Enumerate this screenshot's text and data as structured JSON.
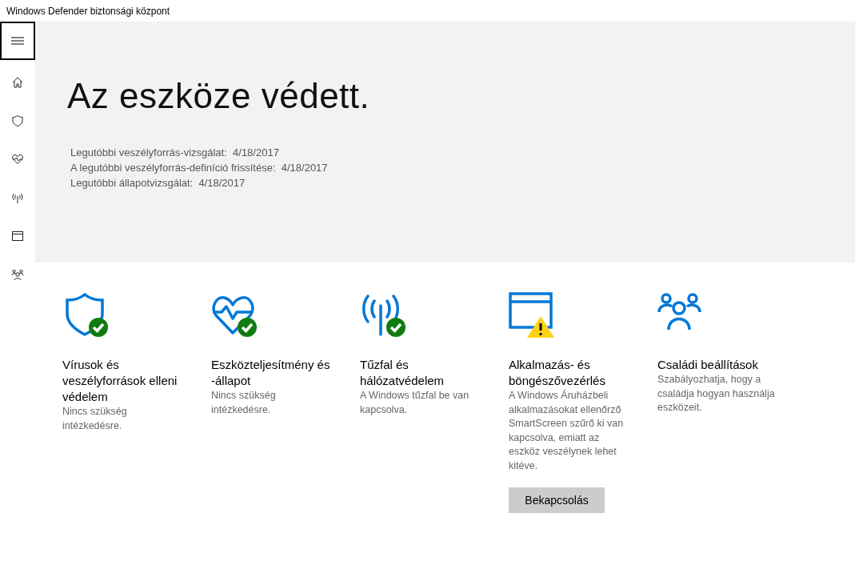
{
  "window": {
    "title": "Windows Defender biztonsági központ"
  },
  "sidebar": {
    "items": [
      {
        "kind": "home"
      },
      {
        "kind": "shield"
      },
      {
        "kind": "heart"
      },
      {
        "kind": "antenna"
      },
      {
        "kind": "browser"
      },
      {
        "kind": "family"
      }
    ]
  },
  "hero": {
    "heading": "Az eszköze védett.",
    "details": [
      "Legutóbbi veszélyforrás-vizsgálat:  4/18/2017",
      "A legutóbbi veszélyforrás-definíció frissítése:  4/18/2017",
      "Legutóbbi állapotvizsgálat:  4/18/2017"
    ]
  },
  "cards": [
    {
      "kind": "shield",
      "badge": {
        "kind": "check"
      },
      "title": "Vírusok és veszélyforrások elleni védelem",
      "description": "Nincs szükség intézkedésre."
    },
    {
      "kind": "heart",
      "badge": {
        "kind": "check"
      },
      "title": "Eszközteljesítmény és -állapot",
      "description": "Nincs szükség intézkedésre."
    },
    {
      "kind": "antenna",
      "badge": {
        "kind": "check"
      },
      "title": "Tűzfal és hálózatvédelem",
      "description": "A Windows tűzfal be van kapcsolva."
    },
    {
      "kind": "browser",
      "badge": {
        "kind": "warning"
      },
      "title": "Alkalmazás- és böngészővezérlés",
      "description": "A Windows Áruházbeli alkalmazásokat ellenőrző SmartScreen szűrő ki van kapcsolva, emiatt az eszköz veszélynek lehet kitéve.",
      "button": "Bekapcsolás"
    },
    {
      "kind": "family",
      "title": "Családi beállítások",
      "description": "Szabályozhatja, hogy a családja hogyan használja eszközeit."
    }
  ]
}
